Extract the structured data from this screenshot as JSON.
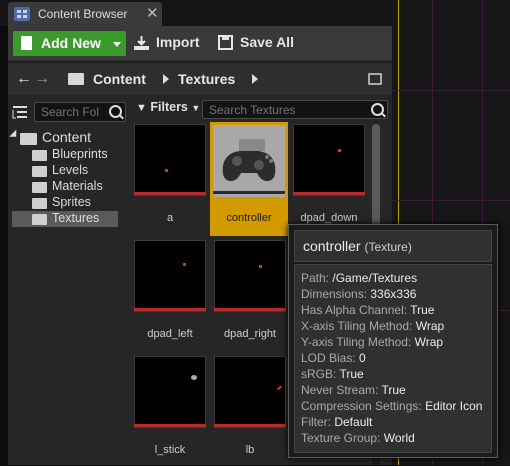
{
  "tab": {
    "title": "Content Browser",
    "close": "✕"
  },
  "toolbar": {
    "add_new": "Add New",
    "import": "Import",
    "save_all": "Save All"
  },
  "path": {
    "crumbs": [
      "Content",
      "Textures"
    ]
  },
  "tree": {
    "search_placeholder": "Search Fol",
    "root": "Content",
    "items": [
      "Blueprints",
      "Levels",
      "Materials",
      "Sprites",
      "Textures"
    ]
  },
  "assets": {
    "filters_label": "Filters",
    "search_placeholder": "Search Textures",
    "tiles": [
      {
        "name": "a"
      },
      {
        "name": "controller"
      },
      {
        "name": "dpad_down"
      },
      {
        "name": "dpad_left"
      },
      {
        "name": "dpad_right"
      },
      {
        "name": "l_stick"
      },
      {
        "name": "lb"
      }
    ]
  },
  "tooltip": {
    "title": "controller",
    "type": "(Texture)",
    "rows": [
      {
        "k": "Path:",
        "v": "/Game/Textures"
      },
      {
        "k": "Dimensions:",
        "v": "336x336"
      },
      {
        "k": "Has Alpha Channel:",
        "v": "True"
      },
      {
        "k": "X-axis Tiling Method:",
        "v": "Wrap"
      },
      {
        "k": "Y-axis Tiling Method:",
        "v": "Wrap"
      },
      {
        "k": "LOD Bias:",
        "v": "0"
      },
      {
        "k": "sRGB:",
        "v": "True"
      },
      {
        "k": "Never Stream:",
        "v": "True"
      },
      {
        "k": "Compression Settings:",
        "v": "Editor Icon"
      },
      {
        "k": "Filter:",
        "v": "Default"
      },
      {
        "k": "Texture Group:",
        "v": "World"
      }
    ]
  },
  "colors": {
    "accent": "#d39a00",
    "add_new": "#3b9a2c",
    "thumb_bar": "#b52a2a"
  }
}
